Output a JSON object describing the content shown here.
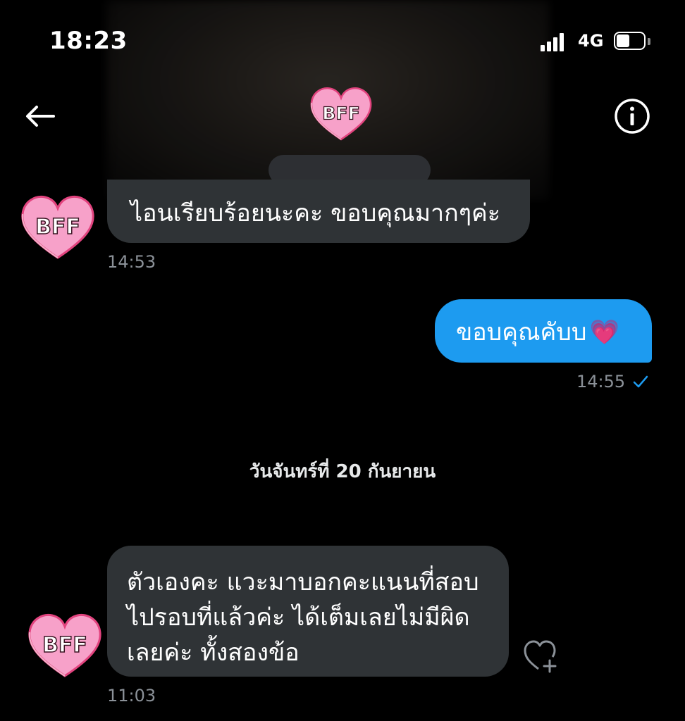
{
  "status_bar": {
    "time": "18:23",
    "network": "4G"
  },
  "header": {
    "back_icon": "arrow-left-icon",
    "info_icon": "info-circle-icon",
    "avatar_text": "BFF"
  },
  "avatar": {
    "text": "BFF",
    "fill": "#f7a1c9",
    "outline": "#e2437e"
  },
  "colors": {
    "incoming_bubble": "#2f3336",
    "outgoing_bubble": "#1d9bf0",
    "timestamp": "#8b9198"
  },
  "messages": [
    {
      "direction": "in",
      "text": "ไอนเรียบร้อยนะคะ ขอบคุณมากๆค่ะ",
      "time": "14:53"
    },
    {
      "direction": "out",
      "text": "ขอบคุณคับบ",
      "emoji": "💗",
      "time": "14:55",
      "status_icon": "check-icon"
    },
    {
      "direction": "in",
      "lines": [
        "ตัวเองคะ แวะมาบอกคะแนนที่สอบ",
        "ไปรอบที่แล้วค่ะ ได้เต็มเลยไม่มีผิด",
        "เลยค่ะ ทั้งสองข้อ"
      ],
      "time": "11:03",
      "reaction_icon": "heart-plus-icon"
    }
  ],
  "date_separator": "วันจันทร์ที่ 20 กันยายน"
}
